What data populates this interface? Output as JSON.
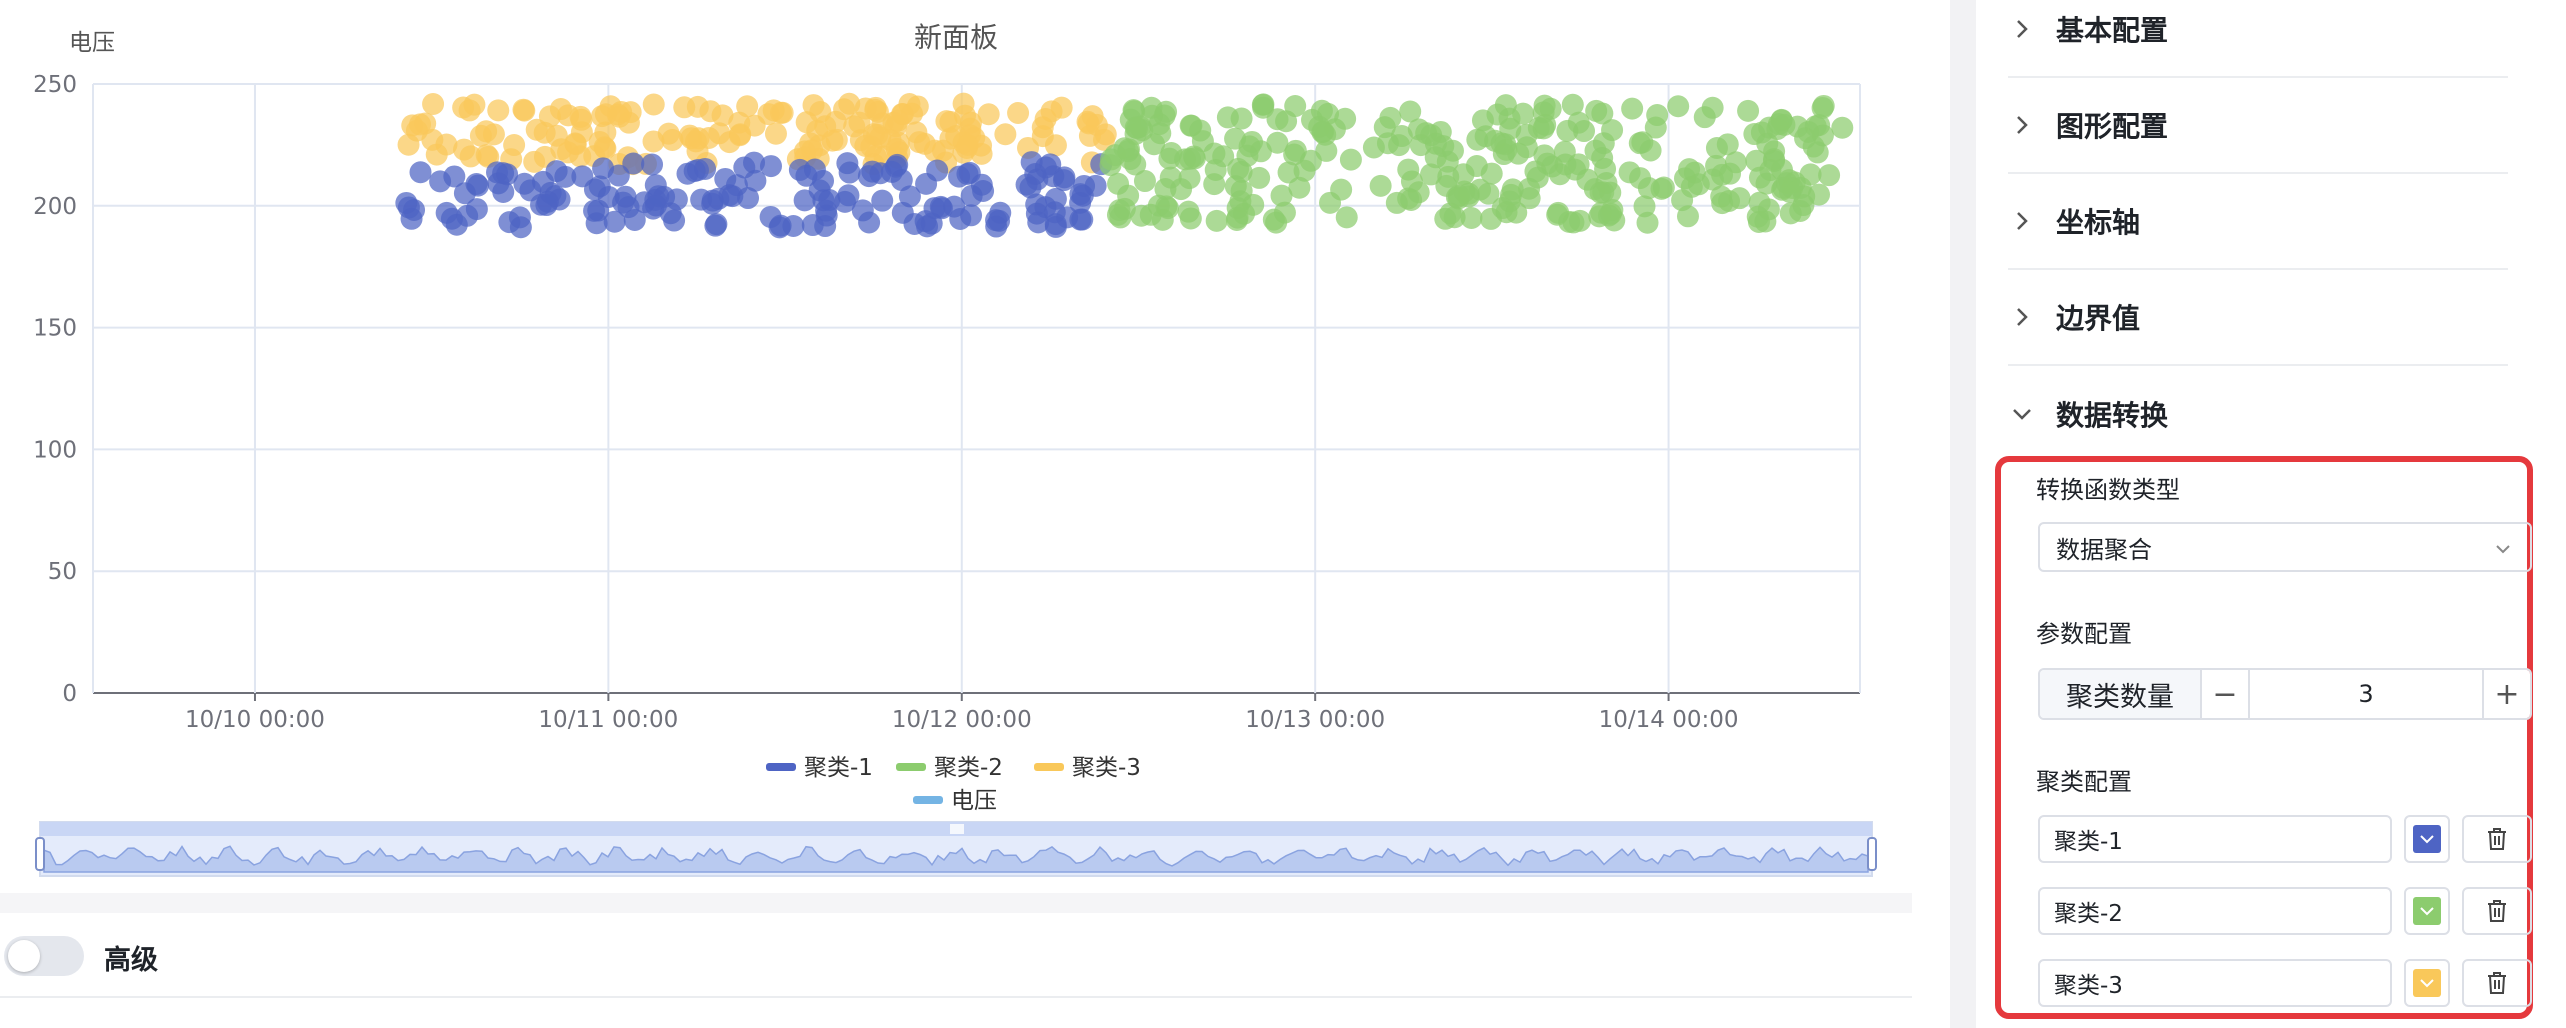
{
  "chart_data": {
    "type": "scatter",
    "title": "新面板",
    "ylabel": "电压",
    "ylim": [
      0,
      250
    ],
    "yticks": [
      "0",
      "50",
      "100",
      "150",
      "200",
      "250"
    ],
    "x_range": [
      "10/09 13:00",
      "10/14 13:00"
    ],
    "xticks": [
      "10/10 00:00",
      "10/11 00:00",
      "10/12 00:00",
      "10/13 00:00",
      "10/14 00:00"
    ],
    "legend_position": "bottom-center",
    "grid": true,
    "series": [
      {
        "name": "聚类-1",
        "color": "#4e64c4",
        "x_range": [
          "10/10 10:00",
          "10/12 10:00"
        ],
        "y_range": [
          191,
          218
        ],
        "count": 160
      },
      {
        "name": "聚类-2",
        "color": "#8ccc6e",
        "x_range": [
          "10/12 10:00",
          "10/14 12:00"
        ],
        "y_range": [
          193,
          243
        ],
        "count": 300
      },
      {
        "name": "聚类-3",
        "color": "#f9c85a",
        "x_range": [
          "10/10 10:00",
          "10/12 10:00"
        ],
        "y_range": [
          217,
          242
        ],
        "count": 170
      }
    ],
    "line_series": {
      "name": "电压",
      "color": "#74b4e4"
    }
  },
  "right_panel": {
    "sections": [
      {
        "label": "基本配置",
        "expanded": false
      },
      {
        "label": "图形配置",
        "expanded": false
      },
      {
        "label": "坐标轴",
        "expanded": false
      },
      {
        "label": "边界值",
        "expanded": false
      },
      {
        "label": "数据转换",
        "expanded": true
      }
    ],
    "transform_type_label": "转换函数类型",
    "transform_type_value": "数据聚合",
    "param_label": "参数配置",
    "cluster_count_label": "聚类数量",
    "cluster_count_value": "3",
    "minus": "−",
    "plus": "+",
    "cluster_config_label": "聚类配置",
    "clusters": [
      {
        "name": "聚类-1",
        "color": "#4e64c4"
      },
      {
        "name": "聚类-2",
        "color": "#8ccc6e"
      },
      {
        "name": "聚类-3",
        "color": "#f9c85a"
      }
    ],
    "highlight_color": "#e5393d"
  },
  "advanced": {
    "label": "高级",
    "enabled": false
  }
}
